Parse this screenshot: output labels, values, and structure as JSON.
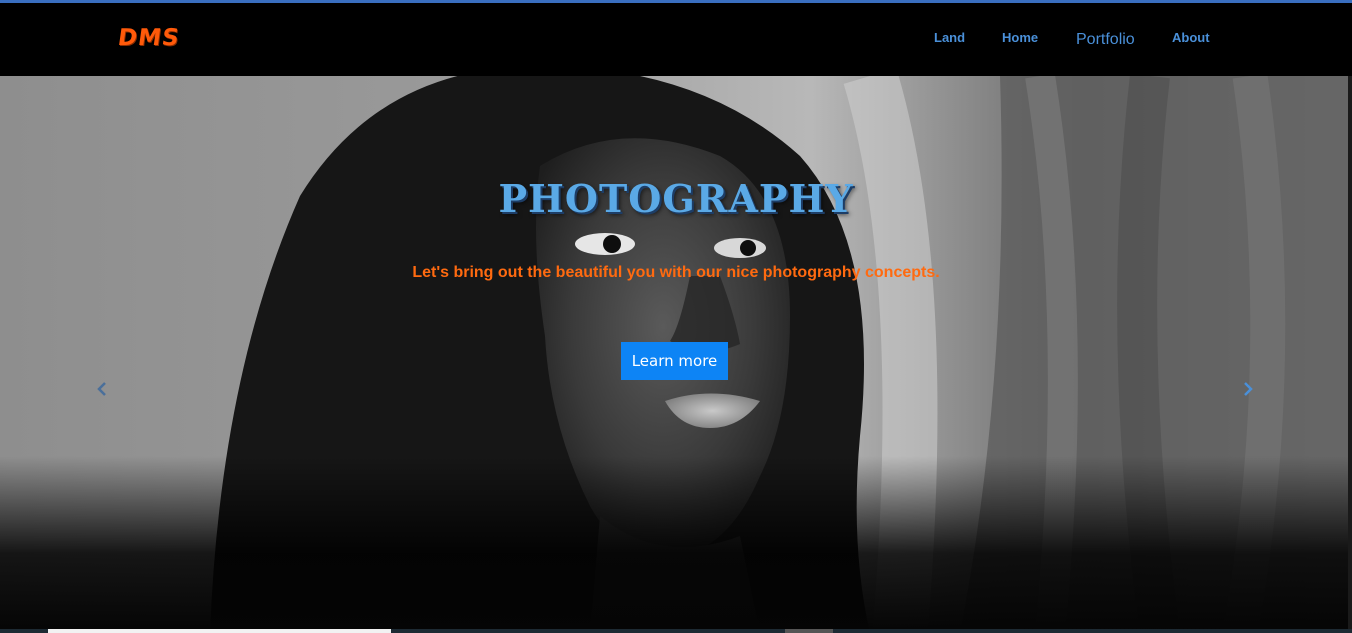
{
  "brand": "DMS",
  "nav": {
    "links": [
      "Land",
      "Home",
      "Portfolio",
      "About"
    ]
  },
  "hero": {
    "title": "PHOTOGRAPHY",
    "subtitle": "Let's bring out the beautiful you with our nice photography concepts.",
    "cta_label": "Learn more",
    "prev_icon": "chevron-left-icon",
    "next_icon": "chevron-right-icon"
  },
  "colors": {
    "brand": "#ff5a0a",
    "nav_link": "#4a90d9",
    "title": "#5aa9e6",
    "subtitle": "#ff6a10",
    "cta_bg": "#0d84f5",
    "navbar_bg": "#000000"
  }
}
